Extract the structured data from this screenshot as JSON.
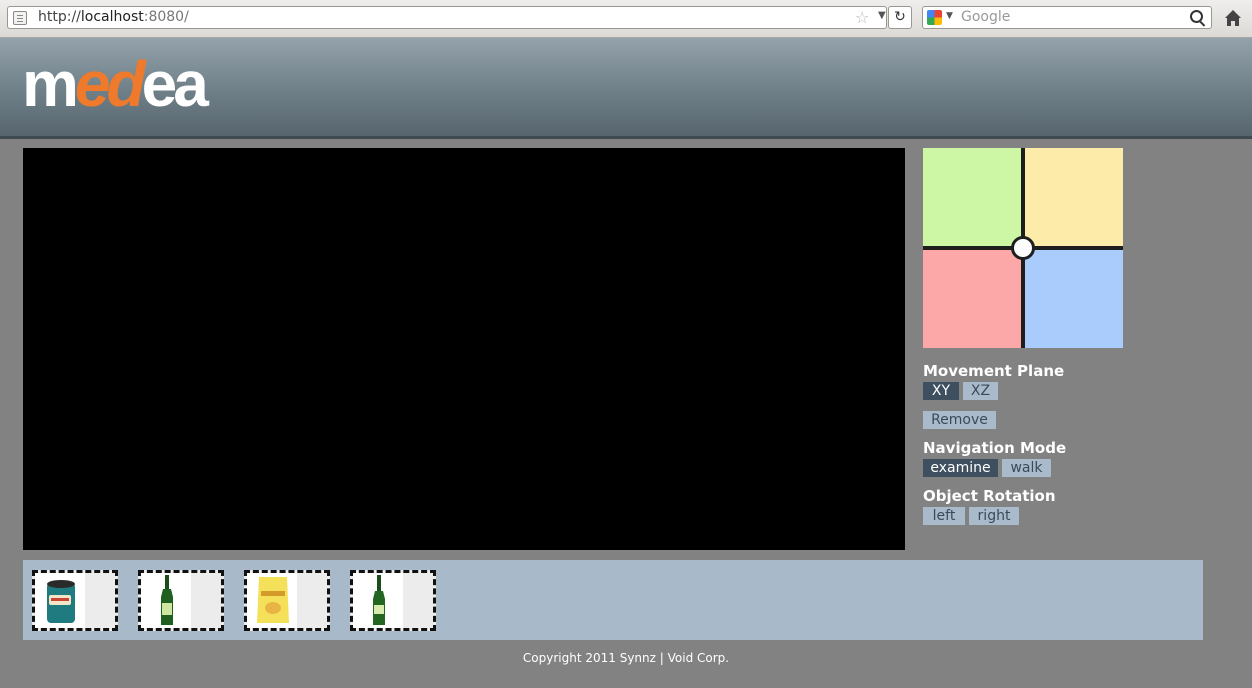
{
  "browser": {
    "url_scheme": "http://",
    "url_host": "localhost",
    "url_port": ":8080/",
    "search_placeholder": "Google",
    "icons": [
      "page-icon",
      "star-icon",
      "dropdown-icon",
      "reload-icon",
      "google-icon",
      "magnifier-icon",
      "home-icon"
    ]
  },
  "header": {
    "logo_prefix": "m",
    "logo_accent": "ed",
    "logo_suffix": "ea",
    "logo_accent_color": "#f07a2c"
  },
  "plane_picker": {
    "colors": {
      "top_left": "#cdf7a4",
      "top_right": "#fdebaa",
      "bottom_left": "#fda8a8",
      "bottom_right": "#aaccfd"
    }
  },
  "controls": {
    "movement_plane": {
      "title": "Movement Plane",
      "options": [
        "XY",
        "XZ"
      ],
      "selected": "XY"
    },
    "remove_label": "Remove",
    "navigation_mode": {
      "title": "Navigation Mode",
      "options": [
        "examine",
        "walk"
      ],
      "selected": "examine"
    },
    "object_rotation": {
      "title": "Object Rotation",
      "options": [
        "left",
        "right"
      ]
    }
  },
  "tray": {
    "items": [
      {
        "icon": "can-icon"
      },
      {
        "icon": "bottle-icon"
      },
      {
        "icon": "chips-bag-icon"
      },
      {
        "icon": "bottle-icon"
      }
    ]
  },
  "footer": {
    "text": "Copyright 2011 Synnz | Void Corp."
  },
  "colors": {
    "button": "#a9bacb",
    "button_active": "#3e4f60",
    "tray": "#a8b9c9"
  }
}
